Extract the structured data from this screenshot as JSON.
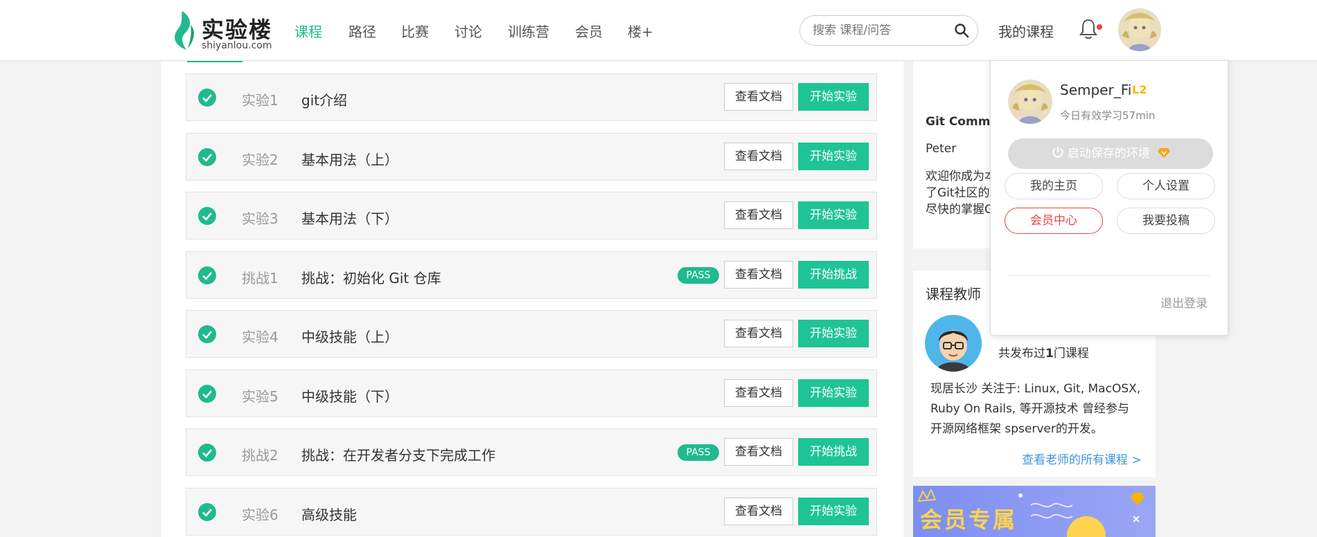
{
  "header": {
    "logo_text": "实验楼",
    "logo_sub": "shiyanlou.com",
    "nav": [
      "课程",
      "路径",
      "比赛",
      "讨论",
      "训练营",
      "会员",
      "楼+"
    ],
    "search_placeholder": "搜索 课程/问答",
    "my_courses": "我的课程",
    "accent_color": "#1fba8e"
  },
  "labs": [
    {
      "num": "实验1",
      "title": "git介绍",
      "pass": "",
      "doc": "查看文档",
      "action": "开始实验"
    },
    {
      "num": "实验2",
      "title": "基本用法（上）",
      "pass": "",
      "doc": "查看文档",
      "action": "开始实验"
    },
    {
      "num": "实验3",
      "title": "基本用法（下）",
      "pass": "",
      "doc": "查看文档",
      "action": "开始实验"
    },
    {
      "num": "挑战1",
      "title": "挑战：初始化 Git 仓库",
      "pass": "PASS",
      "doc": "查看文档",
      "action": "开始挑战"
    },
    {
      "num": "实验4",
      "title": "中级技能（上）",
      "pass": "",
      "doc": "查看文档",
      "action": "开始实验"
    },
    {
      "num": "实验5",
      "title": "中级技能（下）",
      "pass": "",
      "doc": "查看文档",
      "action": "开始实验"
    },
    {
      "num": "挑战2",
      "title": "挑战：在开发者分支下完成工作",
      "pass": "PASS",
      "doc": "查看文档",
      "action": "开始挑战"
    },
    {
      "num": "实验6",
      "title": "高级技能",
      "pass": "",
      "doc": "查看文档",
      "action": "开始实验"
    }
  ],
  "side": {
    "community_title": "Git Commu",
    "author": "Peter",
    "intro_lines": [
      "欢迎你成为本",
      "了Git社区的",
      "尽快的掌握G"
    ],
    "teacher_heading": "课程教师",
    "teacher_count_prefix": "共发布过",
    "teacher_count": "1",
    "teacher_count_suffix": "门课程",
    "teacher_bio_lines": [
      "现居长沙 关注于: Linux, Git, MacOSX,",
      "Ruby On Rails, 等开源技术 曾经参与",
      "开源网络框架 spserver的开发。"
    ],
    "teacher_link": "查看老师的所有课程 >",
    "banner_text": "会员专属"
  },
  "dropdown": {
    "username": "Semper_Fi",
    "level": "L2",
    "study_today": "今日有效学习57min",
    "env_button": "启动保存的环境",
    "my_home": "我的主页",
    "settings": "个人设置",
    "vip_center": "会员中心",
    "contribute": "我要投稿",
    "logout": "退出登录"
  }
}
